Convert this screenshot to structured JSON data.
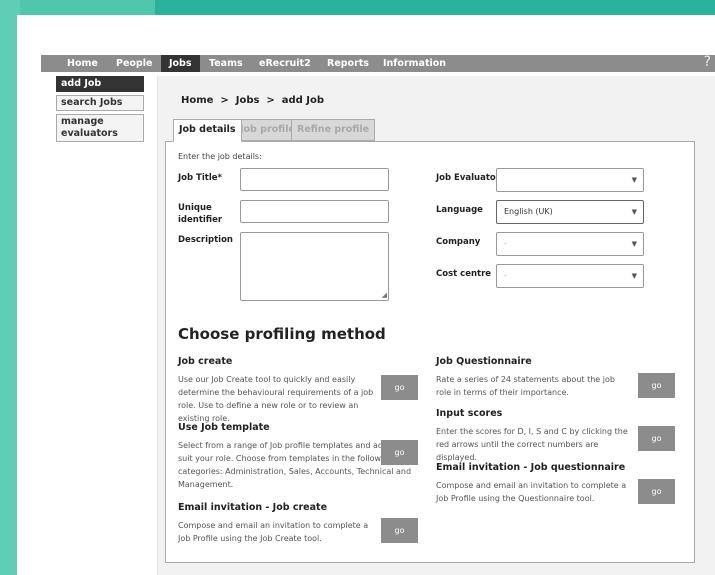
{
  "nav": {
    "items": [
      {
        "label": "Home",
        "active": false
      },
      {
        "label": "People",
        "active": false
      },
      {
        "label": "Jobs",
        "active": true
      },
      {
        "label": "Teams",
        "active": false
      },
      {
        "label": "eRecruit2",
        "active": false
      },
      {
        "label": "Reports",
        "active": false
      },
      {
        "label": "Information",
        "active": false
      }
    ],
    "help_icon": "?"
  },
  "sidebar": {
    "items": [
      {
        "label": "add Job",
        "active": true
      },
      {
        "label": "search Jobs",
        "active": false
      },
      {
        "label": "manage evaluators",
        "active": false
      }
    ]
  },
  "breadcrumb": "Home  >  Jobs  >  add Job",
  "tabs": [
    {
      "label": "Job details",
      "active": true
    },
    {
      "label": "Job profile",
      "active": false
    },
    {
      "label": "Refine profile",
      "active": false
    }
  ],
  "form": {
    "intro": "Enter the job details:",
    "job_title_label": "Job Title*",
    "job_title_value": "",
    "unique_id_label": "Unique identifier",
    "unique_id_value": "",
    "description_label": "Description",
    "description_value": "",
    "job_evaluator_label": "Job Evaluator",
    "job_evaluator_value": "",
    "language_label": "Language",
    "language_value": "English (UK)",
    "company_label": "Company",
    "company_value": "-",
    "cost_centre_label": "Cost centre",
    "cost_centre_value": "-"
  },
  "profiling": {
    "heading": "Choose profiling method",
    "go_label": "go",
    "left": [
      {
        "title": "Job create",
        "description": "Use our Job Create tool to quickly and easily determine the behavioural requirements of a job role. Use to define a new role or to review an existing role."
      },
      {
        "title": "Use Job template",
        "description": "Select from a range of Job profile templates and adjust to suit your role. Choose from templates in the following categories: Administration, Sales, Accounts, Technical and Management."
      },
      {
        "title": "Email invitation - Job create",
        "description": "Compose and email an invitation to complete a Job Profile using the Job Create tool."
      }
    ],
    "right": [
      {
        "title": "Job Questionnaire",
        "description": "Rate a series of 24 statements about the job role in terms of their importance."
      },
      {
        "title": "Input scores",
        "description": "Enter the scores for D, I, S and C by clicking the red arrows until the correct numbers are displayed."
      },
      {
        "title": "Email invitation - Job questionnaire",
        "description": "Compose and email an invitation to complete a Job Profile using the Questionnaire tool."
      }
    ]
  },
  "icons": {
    "dropdown": "chevron-down-icon",
    "resize": "resize-grip-icon",
    "help": "help-icon"
  },
  "colors": {
    "nav_bg": "#8c8c8c",
    "nav_active": "#333333",
    "go_button": "#8c8c8c",
    "background": "#4fc6ae"
  }
}
